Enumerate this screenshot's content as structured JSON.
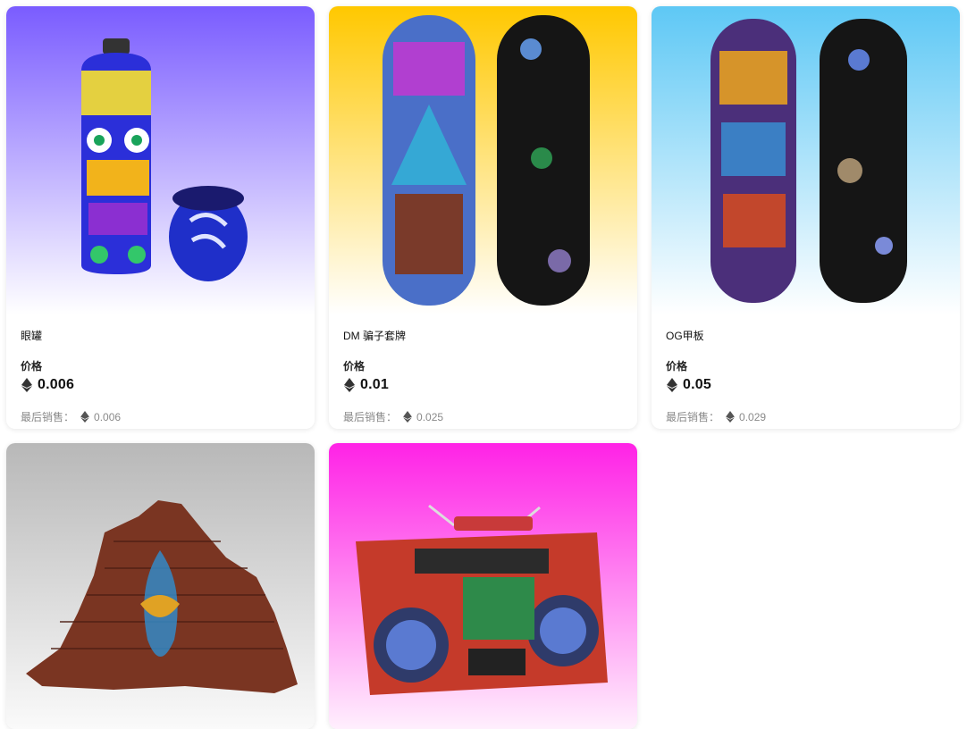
{
  "cards": [
    {
      "name": "眼罐",
      "price_label": "价格",
      "price": "0.006",
      "last_sale_label": "最后销售：",
      "last_sale": "0.006",
      "bg_top": "#7a5cff",
      "bg_bottom": "#ffffff",
      "image": "spray-can-art"
    },
    {
      "name": "DM 骗子套牌",
      "price_label": "价格",
      "price": "0.01",
      "last_sale_label": "最后销售：",
      "last_sale": "0.025",
      "bg_top": "#ffc800",
      "bg_bottom": "#ffffff",
      "image": "skateboard-deck-pair"
    },
    {
      "name": "OG甲板",
      "price_label": "价格",
      "price": "0.05",
      "last_sale_label": "最后销售：",
      "last_sale": "0.029",
      "bg_top": "#5ec8f5",
      "bg_bottom": "#ffffff",
      "image": "skateboard-deck-pair"
    },
    {
      "image": "brick-wall-art",
      "bg_top": "#b8b8b8",
      "bg_bottom": "#ffffff"
    },
    {
      "image": "boombox-art",
      "bg_top": "#ff22e6",
      "bg_bottom": "#ffffff"
    }
  ],
  "eth_icon": "ethereum-icon"
}
